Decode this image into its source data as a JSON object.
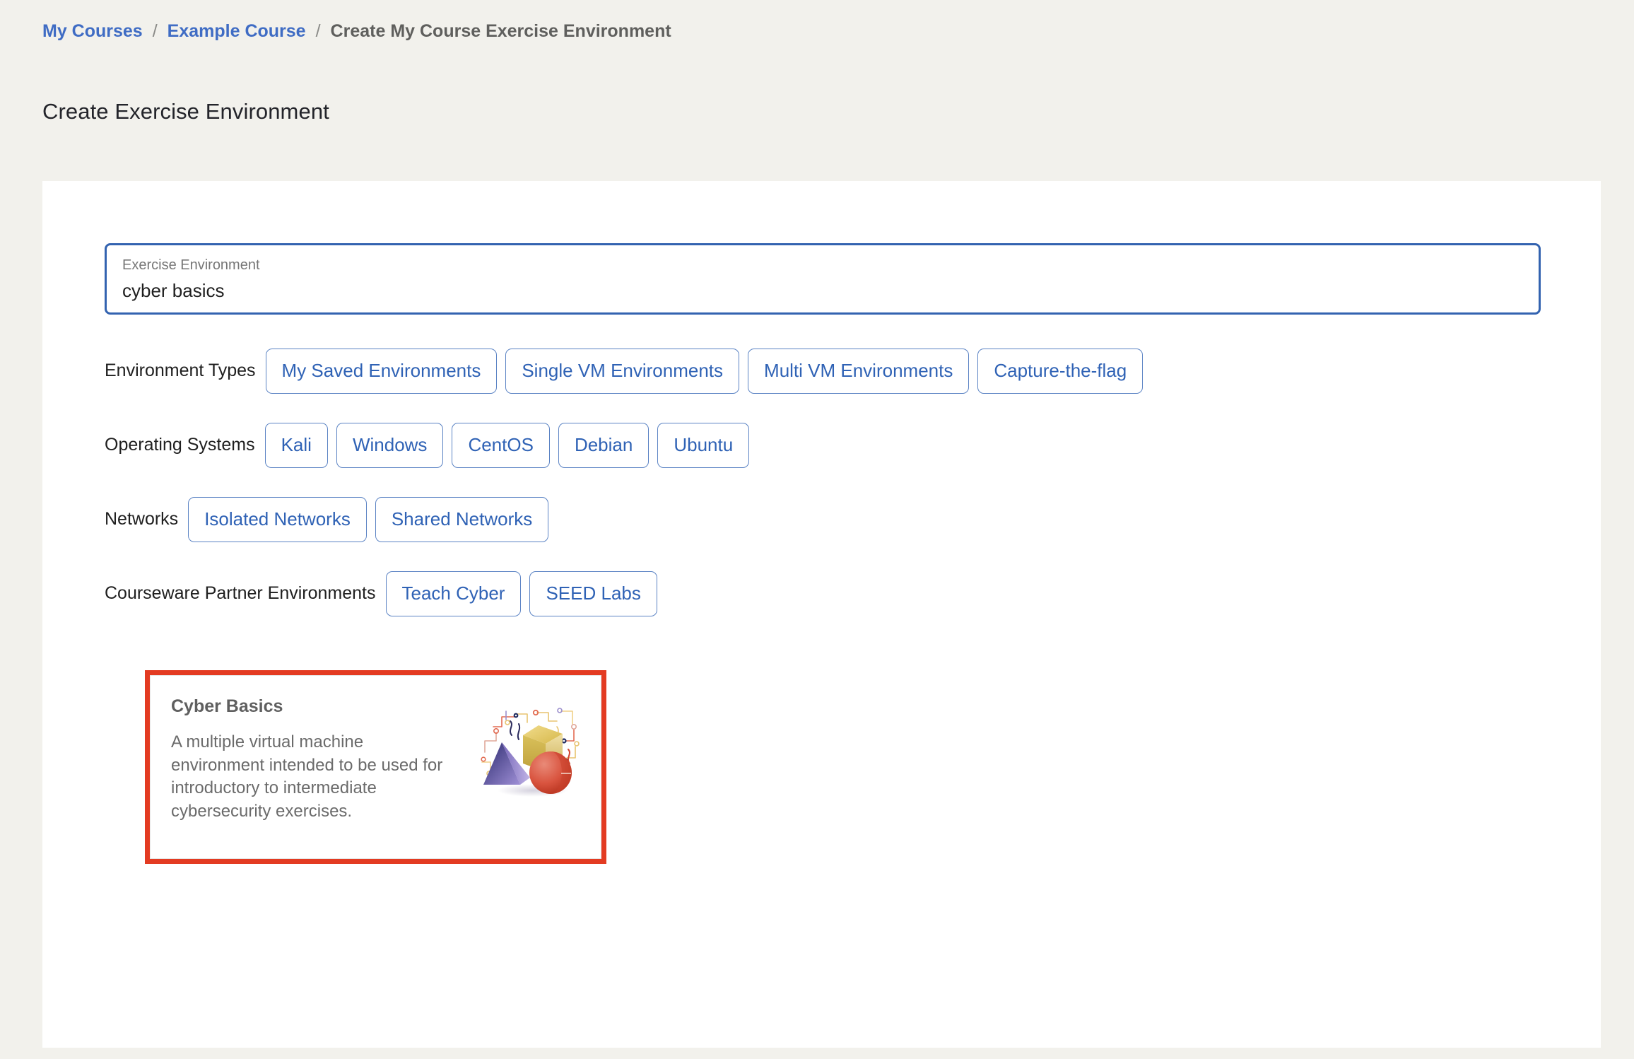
{
  "breadcrumb": {
    "items": [
      {
        "label": "My Courses",
        "type": "link"
      },
      {
        "label": "Example Course",
        "type": "link"
      },
      {
        "label": "Create My Course Exercise Environment",
        "type": "current"
      }
    ],
    "separator": "/"
  },
  "page": {
    "title": "Create Exercise Environment"
  },
  "form": {
    "name_field": {
      "label": "Exercise Environment",
      "value": "cyber basics",
      "focused": true,
      "focus_color": "#3363b0"
    }
  },
  "filters": [
    {
      "label": "Environment Types",
      "chips": [
        "My Saved Environments",
        "Single VM Environments",
        "Multi VM Environments",
        "Capture-the-flag"
      ]
    },
    {
      "label": "Operating Systems",
      "chips": [
        "Kali",
        "Windows",
        "CentOS",
        "Debian",
        "Ubuntu"
      ]
    },
    {
      "label": "Networks",
      "chips": [
        "Isolated Networks",
        "Shared Networks"
      ]
    },
    {
      "label": "Courseware Partner Environments",
      "chips": [
        "Teach Cyber",
        "SEED Labs"
      ]
    }
  ],
  "results": [
    {
      "title": "Cyber Basics",
      "description": "A multiple virtual machine environment intended to be used for introductory to intermediate cybersecurity exercises.",
      "highlighted": true,
      "highlight_color": "#e33b22",
      "artwork": "3d-shapes-circuit-illustration"
    }
  ],
  "colors": {
    "page_background": "#f2f1ec",
    "panel_background": "#ffffff",
    "link_blue": "#3f6cc4",
    "chip_blue": "#2f62b5",
    "chip_border": "#5b83c4",
    "heading": "#23242a",
    "muted_text": "#6b6b6b"
  }
}
